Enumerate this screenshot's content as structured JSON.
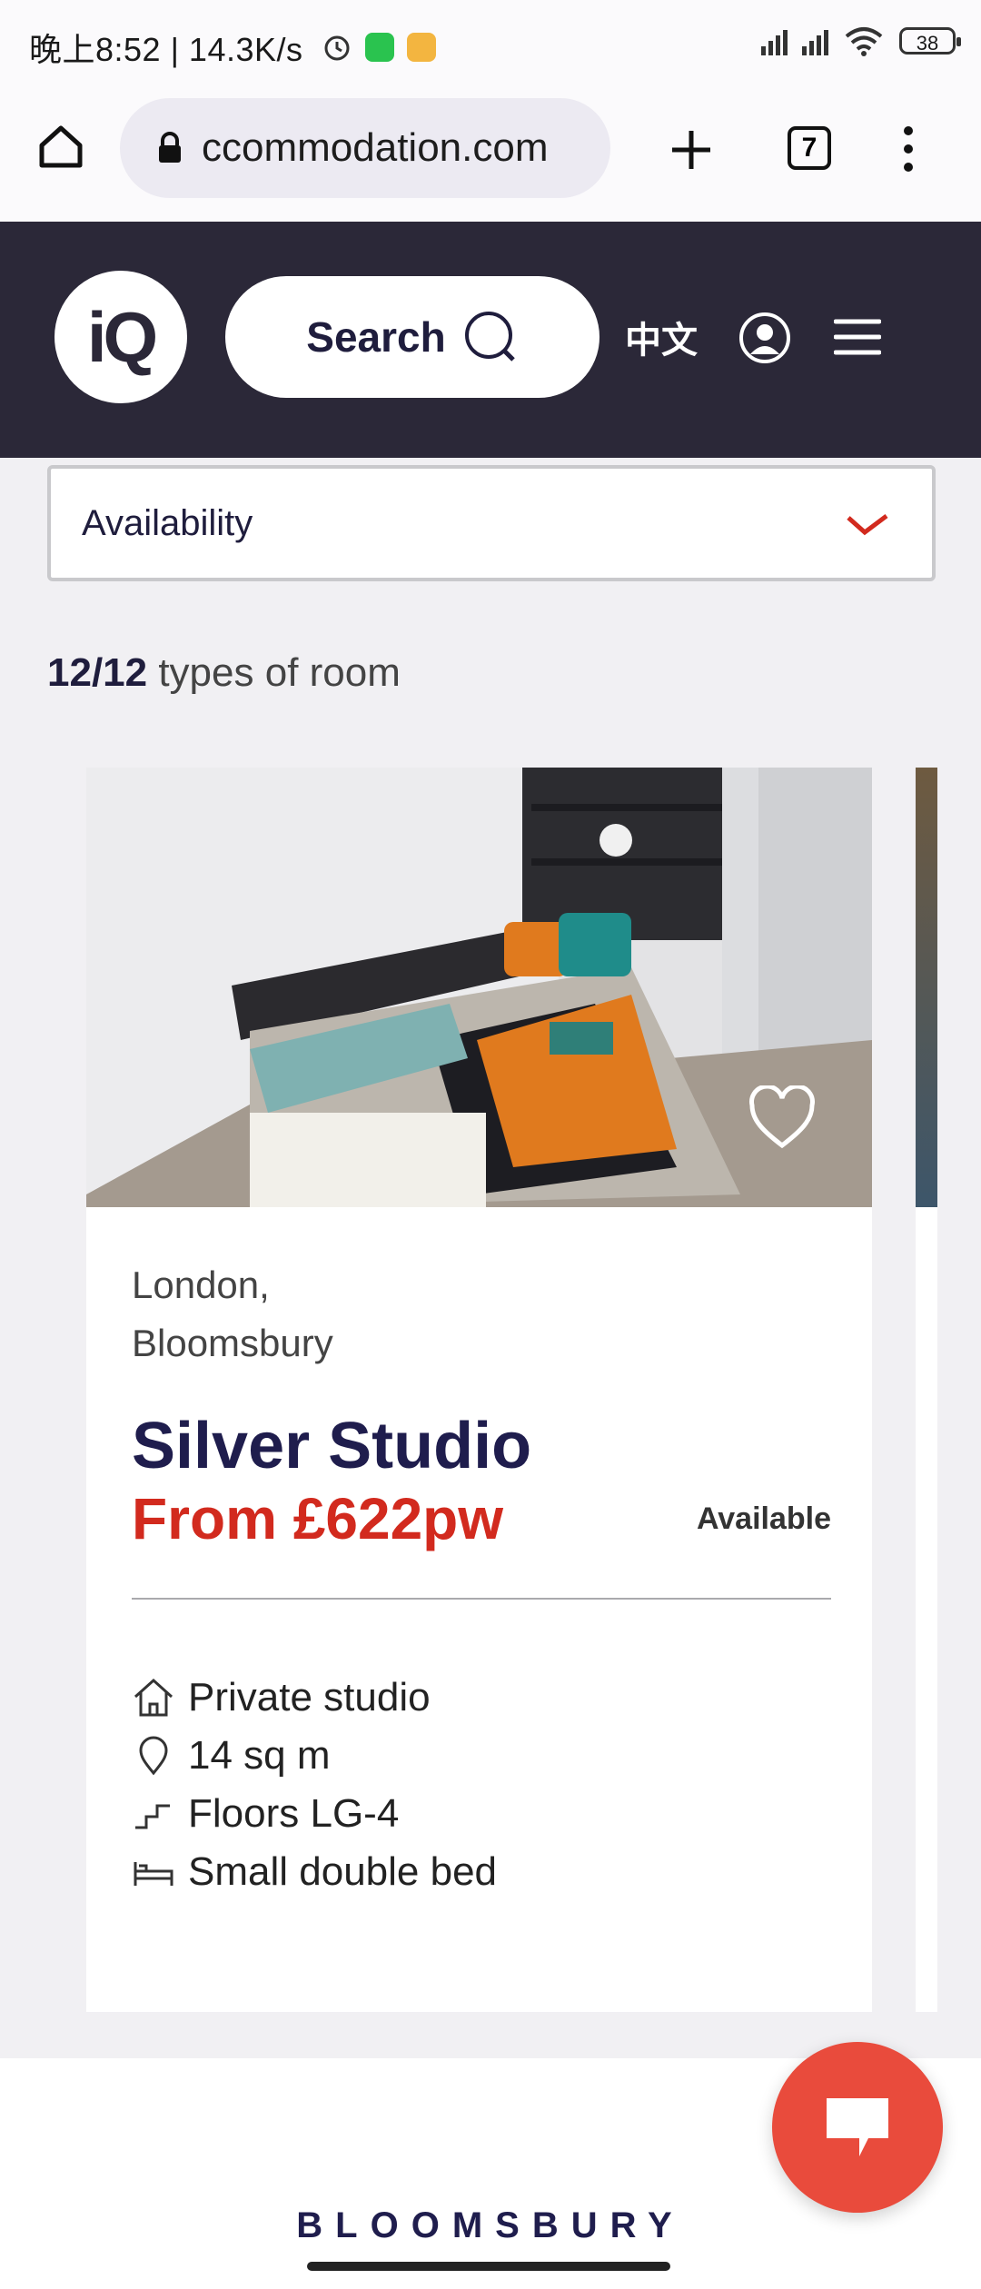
{
  "status_bar": {
    "time_speed": "晚上8:52 | 14.3K/s",
    "battery": "38"
  },
  "browser": {
    "url": "ccommodation.com",
    "tab_count": "7"
  },
  "header": {
    "logo_text": "iQ",
    "search_label": "Search",
    "language_label": "中文"
  },
  "filter": {
    "availability_label": "Availability"
  },
  "results": {
    "count": "12/12",
    "suffix": " types of room"
  },
  "room_card": {
    "location_line1": "London,",
    "location_line2": "Bloomsbury",
    "name": "Silver Studio",
    "price": "From £622pw",
    "availability": "Available",
    "features": [
      {
        "icon": "house-icon",
        "label": "Private studio"
      },
      {
        "icon": "location-pin-icon",
        "label": "14 sq m"
      },
      {
        "icon": "stairs-icon",
        "label": "Floors LG-4"
      },
      {
        "icon": "bed-icon",
        "label": "Small double bed"
      }
    ]
  },
  "footer": {
    "section_title": "BLOOMSBURY"
  },
  "colors": {
    "header_bg": "#2b2838",
    "price_red": "#d22a1e",
    "chat_button": "#e94b3c",
    "title_navy": "#1f1d4d"
  }
}
